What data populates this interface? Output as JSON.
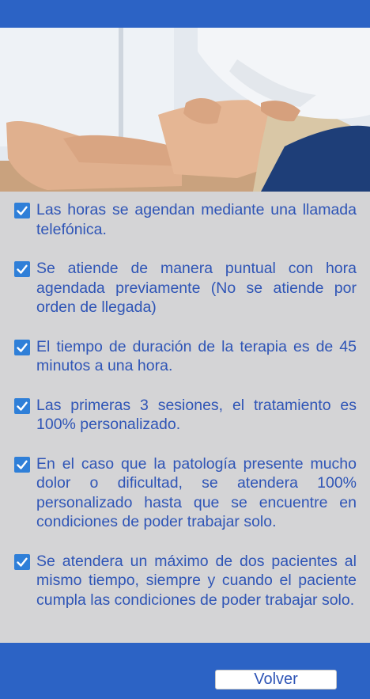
{
  "colors": {
    "brand_blue": "#2c63c5",
    "panel_gray": "#d4d4d6",
    "text_blue": "#2f55b6",
    "check_blue": "#2f7fd8"
  },
  "hero": {
    "image": "physiotherapist-examining-patient-knee-photo"
  },
  "items": [
    {
      "icon": "checkbox-checked-icon",
      "text": "Las horas se agendan mediante una llamada telefónica."
    },
    {
      "icon": "checkbox-checked-icon",
      "text": "Se atiende de manera puntual con hora agendada previamente (No se atiende por orden de llegada)"
    },
    {
      "icon": "checkbox-checked-icon",
      "text": "El tiempo de duración de la terapia es de 45 minutos a una hora."
    },
    {
      "icon": "checkbox-checked-icon",
      "text": "Las primeras 3 sesiones, el tratamiento es 100% personalizado."
    },
    {
      "icon": "checkbox-checked-icon",
      "text": "En el caso que la patología presente mucho dolor o dificultad, se atendera 100% personalizado hasta que se encuentre en condiciones de poder trabajar solo."
    },
    {
      "icon": "checkbox-checked-icon",
      "text": "Se atendera un máximo de dos pacientes al mismo tiempo, siempre y cuando el paciente cumpla las condiciones de poder trabajar solo."
    }
  ],
  "footer": {
    "back_label": "Volver"
  }
}
